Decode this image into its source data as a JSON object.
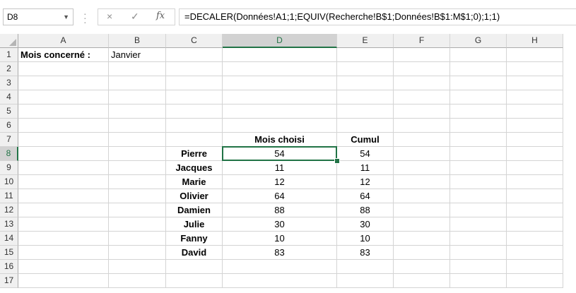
{
  "name_box": {
    "value": "D8"
  },
  "formula_bar": {
    "cancel_icon": "×",
    "enter_icon": "✓",
    "fx_label": "fx",
    "formula": "=DECALER(Données!A1;1;EQUIV(Recherche!B$1;Données!B$1:M$1;0);1;1)"
  },
  "columns": [
    "A",
    "B",
    "C",
    "D",
    "E",
    "F",
    "G",
    "H"
  ],
  "rows": [
    "1",
    "2",
    "3",
    "4",
    "5",
    "6",
    "7",
    "8",
    "9",
    "10",
    "11",
    "12",
    "13",
    "14",
    "15",
    "16",
    "17"
  ],
  "active_cell": "D8",
  "colors": {
    "accent": "#217346"
  },
  "cells": {
    "A1": "Mois concerné :",
    "B1": "Janvier",
    "D7": "Mois choisi",
    "E7": "Cumul",
    "C8": "Pierre",
    "D8": "54",
    "E8": "54",
    "C9": "Jacques",
    "D9": "11",
    "E9": "11",
    "C10": "Marie",
    "D10": "12",
    "E10": "12",
    "C11": "Olivier",
    "D11": "64",
    "E11": "64",
    "C12": "Damien",
    "D12": "88",
    "E12": "88",
    "C13": "Julie",
    "D13": "30",
    "E13": "30",
    "C14": "Fanny",
    "D14": "10",
    "E14": "10",
    "C15": "David",
    "D15": "83",
    "E15": "83"
  }
}
